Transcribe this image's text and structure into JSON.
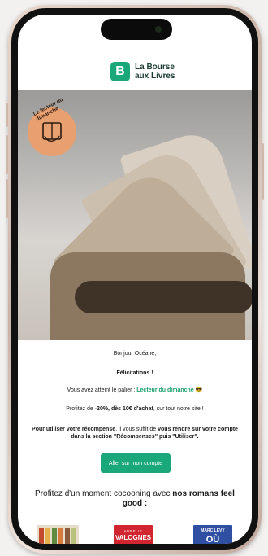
{
  "brand": {
    "logo_letter": "B",
    "name_line1": "La Bourse",
    "name_line2": "aux Livres"
  },
  "hero": {
    "badge_text": "Le lecteur du dimanche"
  },
  "email": {
    "greeting": "Bonjour Océane,",
    "congrats": "Félicitations !",
    "level_prefix": "Vous avez atteint le palier : ",
    "level_name": "Lecteur du dimanche",
    "level_emoji": "😎",
    "offer_prefix": "Profitez de ",
    "offer_bold": "-20%, dès 10€ d'achat",
    "offer_suffix": ", sur tout notre site !",
    "usage_bold1": "Pour utiliser votre récompense",
    "usage_mid": ", il vous suffit de ",
    "usage_bold2": "vous rendre sur votre compte dans la section \"Récompenses\" puis \"Utiliser\".",
    "cta_label": "Aller sur mon compte",
    "promo_text": "Profitez d'un moment cocooning avec ",
    "promo_bold": "nos romans feel good :"
  },
  "books": [
    {
      "title": ""
    },
    {
      "author": "AURELIE",
      "title": "VALOGNES"
    },
    {
      "author": "MARC LEVY",
      "title": "OÙ"
    }
  ],
  "colors": {
    "accent": "#1aa779",
    "badge": "#e8a070"
  }
}
